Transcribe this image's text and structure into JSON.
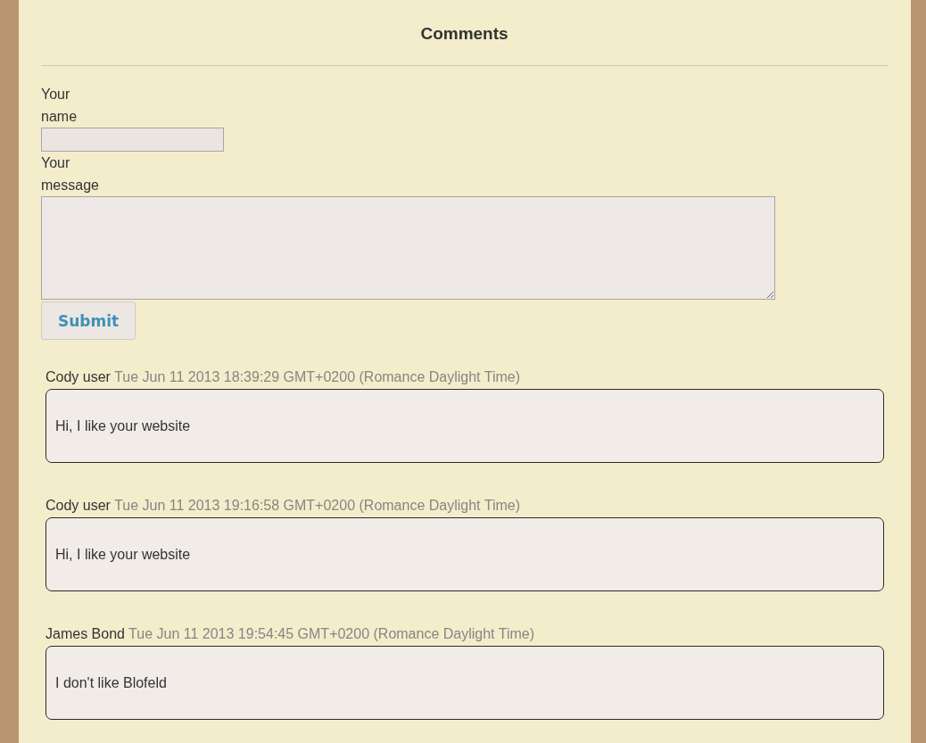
{
  "heading": "Comments",
  "form": {
    "fields": [
      {
        "kind": "text",
        "label": "Your name"
      },
      {
        "kind": "textarea",
        "label": "Your message"
      }
    ],
    "submit": "Submit"
  },
  "comments": [
    {
      "author": "Cody user",
      "date": "Tue Jun 11 2013 18:39:29 GMT+0200 (Romance Daylight Time)",
      "message": "Hi, I like your website"
    },
    {
      "author": "Cody user",
      "date": "Tue Jun 11 2013 19:16:58 GMT+0200 (Romance Daylight Time)",
      "message": "Hi, I like your website"
    },
    {
      "author": "James Bond",
      "date": "Tue Jun 11 2013 19:54:45 GMT+0200 (Romance Daylight Time)",
      "message": "I don't like Blofeld"
    }
  ]
}
